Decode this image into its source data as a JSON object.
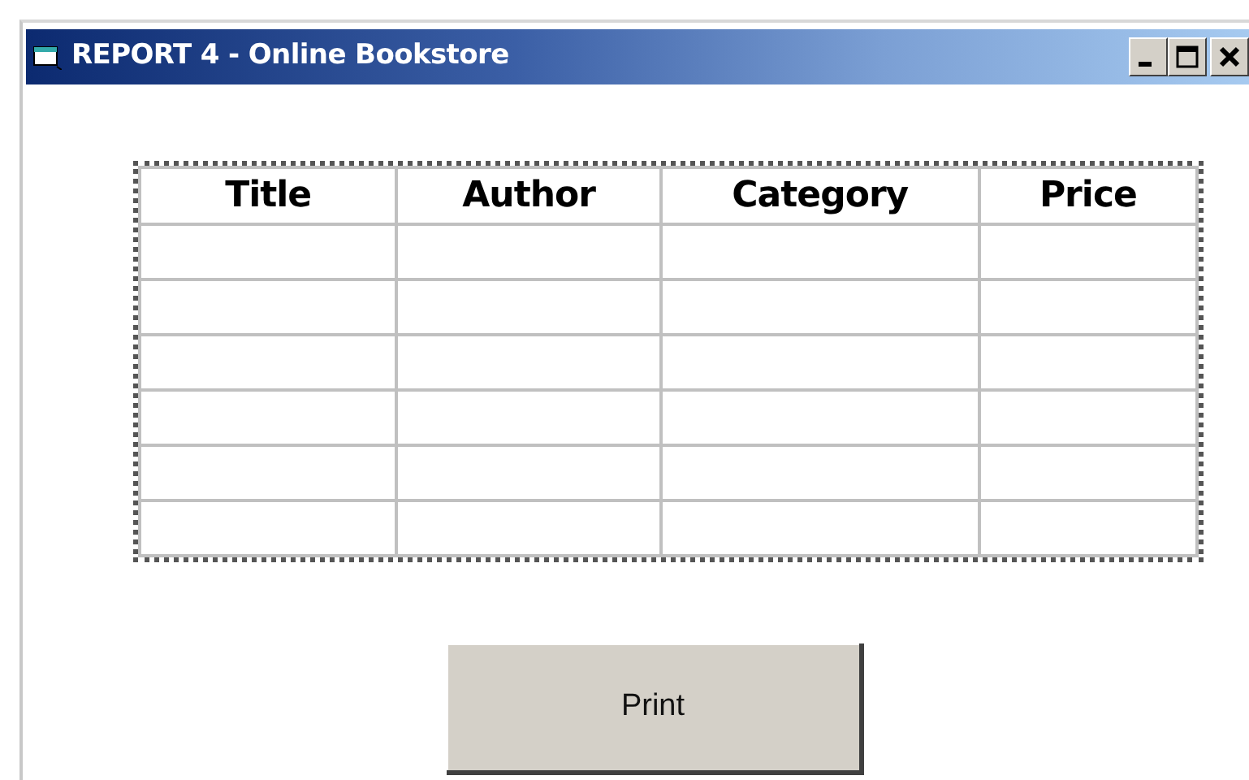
{
  "window": {
    "title": "REPORT 4 - Online Bookstore"
  },
  "table": {
    "columns": [
      "Title",
      "Author",
      "Category",
      "Price"
    ],
    "rows": [
      {
        "kind": "empty"
      },
      {
        "kind": "empty"
      },
      {
        "kind": "empty"
      },
      {
        "kind": "empty"
      },
      {
        "kind": "empty"
      },
      {
        "kind": "empty"
      }
    ]
  },
  "buttons": [
    "Print"
  ]
}
